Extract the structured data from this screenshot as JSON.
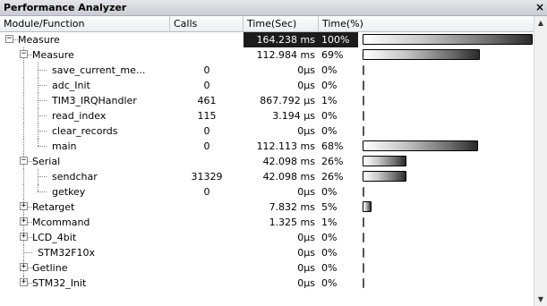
{
  "window": {
    "title": "Performance Analyzer",
    "close_glyph": "×"
  },
  "columns": [
    "Module/Function",
    "Calls",
    "Time(Sec)",
    "Time(%)"
  ],
  "scroll": {
    "up_glyph": "▲",
    "down_glyph": "▼"
  },
  "rows": [
    {
      "level": 0,
      "toggle": "−",
      "name": "Measure",
      "calls": "",
      "time": "164.238 ms",
      "pct": "100%",
      "fraction": 1.0,
      "highlight": true
    },
    {
      "level": 1,
      "toggle": "−",
      "name": "Measure",
      "calls": "",
      "time": "112.984 ms",
      "pct": "69%",
      "fraction": 0.69
    },
    {
      "level": 2,
      "toggle": "",
      "name": "save_current_me...",
      "calls": "0",
      "time": "0µs",
      "pct": "0%",
      "fraction": 0
    },
    {
      "level": 2,
      "toggle": "",
      "name": "adc_Init",
      "calls": "0",
      "time": "0µs",
      "pct": "0%",
      "fraction": 0
    },
    {
      "level": 2,
      "toggle": "",
      "name": "TIM3_IRQHandler",
      "calls": "461",
      "time": "867.792 µs",
      "pct": "1%",
      "fraction": 0.01
    },
    {
      "level": 2,
      "toggle": "",
      "name": "read_index",
      "calls": "115",
      "time": "3.194 µs",
      "pct": "0%",
      "fraction": 0
    },
    {
      "level": 2,
      "toggle": "",
      "name": "clear_records",
      "calls": "0",
      "time": "0µs",
      "pct": "0%",
      "fraction": 0
    },
    {
      "level": 2,
      "toggle": "",
      "name": "main",
      "calls": "0",
      "time": "112.113 ms",
      "pct": "68%",
      "fraction": 0.68
    },
    {
      "level": 1,
      "toggle": "−",
      "name": "Serial",
      "calls": "",
      "time": "42.098 ms",
      "pct": "26%",
      "fraction": 0.26
    },
    {
      "level": 2,
      "toggle": "",
      "name": "sendchar",
      "calls": "31329",
      "time": "42.098 ms",
      "pct": "26%",
      "fraction": 0.26
    },
    {
      "level": 2,
      "toggle": "",
      "name": "getkey",
      "calls": "0",
      "time": "0µs",
      "pct": "0%",
      "fraction": 0
    },
    {
      "level": 1,
      "toggle": "+",
      "name": "Retarget",
      "calls": "",
      "time": "7.832 ms",
      "pct": "5%",
      "fraction": 0.05
    },
    {
      "level": 1,
      "toggle": "+",
      "name": "Mcommand",
      "calls": "",
      "time": "1.325 ms",
      "pct": "1%",
      "fraction": 0.01
    },
    {
      "level": 1,
      "toggle": "+",
      "name": "LCD_4bit",
      "calls": "",
      "time": "0µs",
      "pct": "0%",
      "fraction": 0
    },
    {
      "level": 1,
      "toggle": "",
      "name": "STM32F10x",
      "calls": "",
      "time": "0µs",
      "pct": "0%",
      "fraction": 0
    },
    {
      "level": 1,
      "toggle": "+",
      "name": "Getline",
      "calls": "",
      "time": "0µs",
      "pct": "0%",
      "fraction": 0
    },
    {
      "level": 1,
      "toggle": "+",
      "name": "STM32_Init",
      "calls": "",
      "time": "0µs",
      "pct": "0%",
      "fraction": 0
    }
  ]
}
